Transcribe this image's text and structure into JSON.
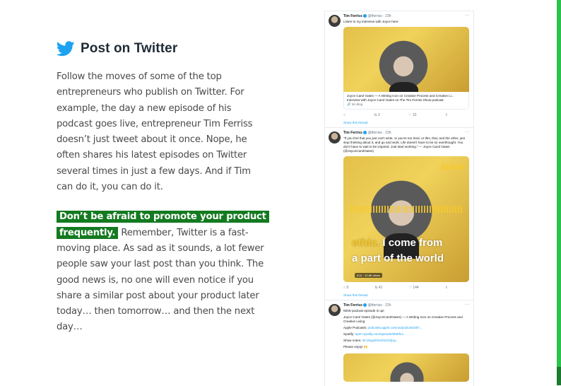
{
  "article": {
    "heading": "Post on Twitter",
    "paragraph1": "Follow the moves of some of the top entrepreneurs who publish on Twitter. For example, the day a new episode of his podcast goes live, entrepreneur Tim Ferriss doesn’t just tweet about it once. Nope, he often shares his latest episodes on Twitter several times in just a few days. And if Tim can do it, you can do it.",
    "highlight": "Don’t be afraid to promote your product frequently.",
    "paragraph2_rest": " Remember, Twitter is a fast-moving place. As sad as it sounds, a lot fewer people saw your last post than you think. The good news is, no one will even notice if you share a similar post about your product later today… then tomorrow… and then the next day…"
  },
  "colors": {
    "accent_green": "#137a1f",
    "bar_green": "#2bc24d",
    "twitter_blue": "#1da1f2"
  },
  "tweets": [
    {
      "name": "Tim Ferriss",
      "handle": "@tferriss · 23h",
      "text": "Listen to my interview with Joyce here:",
      "card_title": "Joyce Carol Oates — A Writing Icon on Creative Process and Creative Li... Interview with Joyce Carol Oates on The Tim Ferriss Show podcast.",
      "card_url": "🔗 tim.blog",
      "replies": "",
      "retweets": "2",
      "likes": "10",
      "show_thread": "Show this thread"
    },
    {
      "name": "Tim Ferriss",
      "handle": "@tferriss · 23h",
      "text": "\"If you feel that you just can't write, or you're too tired, or this, that, and the other, just stop thinking about it, and go and work. Life doesn't have to be so overthought. You don't have to wait to be inspired. Just start working.\" — Joyce Carol Oates (@JoyceCarolOates)",
      "video_top": "SHOW",
      "video_line1_accent": "ethic.",
      "video_line1": " I come from",
      "video_line2": "a part of the world",
      "video_badge": "0:11 · 12.8K views",
      "replies": "9",
      "retweets": "41",
      "likes": "144",
      "show_thread": "Show this thread"
    },
    {
      "name": "Tim Ferriss",
      "handle": "@tferriss · 22h",
      "text": "NEW podcast episode is up!",
      "quote": "Joyce Carol Oates (@JoyceCarolOates) — A Writing Icon on Creative Process and Creative Living",
      "apple": "Apple Podcasts: ",
      "apple_link": "podcasts.apple.com/us/podcast/487...",
      "spotify": "Spotify: ",
      "spotify_link": "open.spotify.com/episode/6M0fco...",
      "shownotes": "Show notes: ",
      "shownotes_link": "tim.blog/2021/02/10/joy...",
      "enjoy": "Please enjoy! 🙌"
    }
  ]
}
